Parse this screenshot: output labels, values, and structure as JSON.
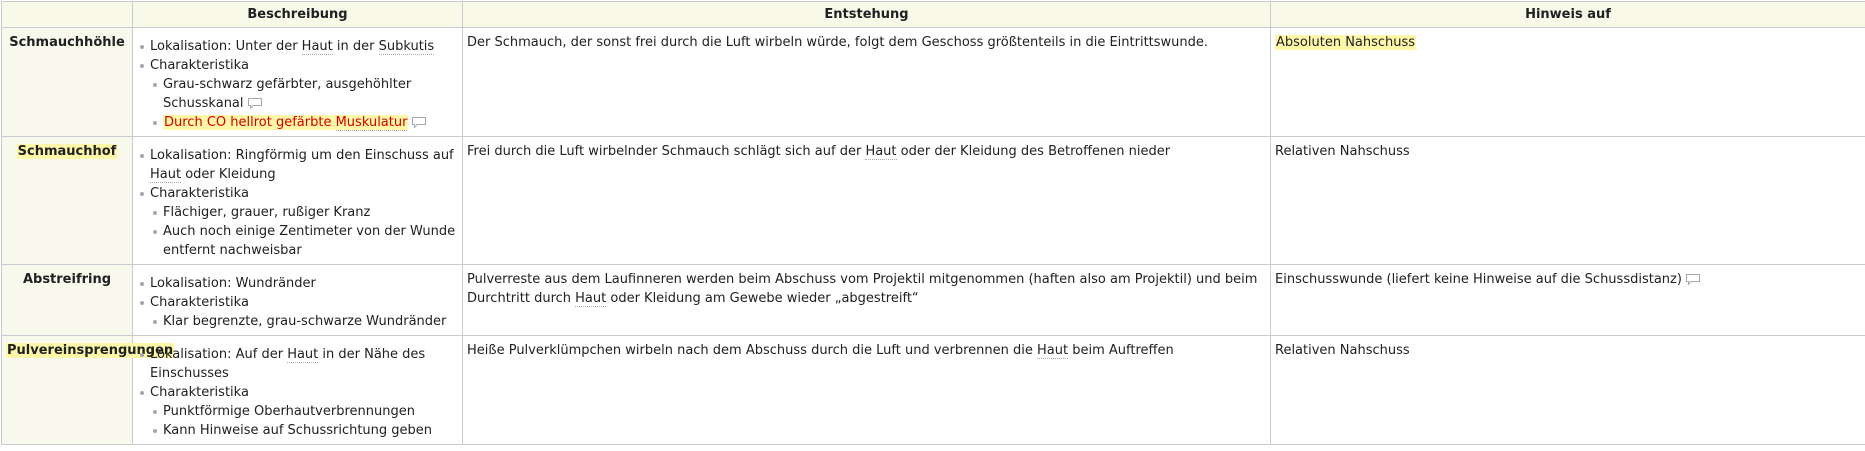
{
  "header": {
    "col_label": "",
    "col_beschreibung": "Beschreibung",
    "col_entstehung": "Entstehung",
    "col_hinweis": "Hinweis auf"
  },
  "rows": [
    {
      "label": "Schmauchhöhle",
      "lokalisation_prefix": "Lokalisation: Unter der ",
      "lokalisation_link1": "Haut",
      "lokalisation_mid": " in der ",
      "lokalisation_link2": "Subkutis",
      "charakteristika": "Charakteristika",
      "sub1": "Grau-schwarz gefärbter, ausgehöhlter Schusskanal",
      "sub2_prefix": "Durch CO hellrot gefärbte ",
      "sub2_link": "Muskulatur",
      "entstehung": "Der Schmauch, der sonst frei durch die Luft wirbeln würde, folgt dem Geschoss größtenteils in die Eintrittswunde.",
      "hinweis": "Absoluten Nahschuss"
    },
    {
      "label": "Schmauchhof",
      "lokalisation_prefix": "Lokalisation: Ringförmig um den Einschuss auf ",
      "lokalisation_link": "Haut",
      "lokalisation_suffix": " oder Kleidung",
      "charakteristika": "Charakteristika",
      "sub1": "Flächiger, grauer, rußiger Kranz",
      "sub2": "Auch noch einige Zentimeter von der Wunde entfernt nachweisbar",
      "entstehung_prefix": "Frei durch die Luft wirbelnder Schmauch schlägt sich auf der ",
      "entstehung_link": "Haut",
      "entstehung_suffix": " oder der Kleidung des Betroffenen nieder",
      "hinweis": "Relativen Nahschuss"
    },
    {
      "label": "Abstreifring",
      "lokalisation": "Lokalisation: Wundränder",
      "charakteristika": "Charakteristika",
      "sub1": "Klar begrenzte, grau-schwarze Wundränder",
      "entstehung_prefix": "Pulverreste aus dem Laufinneren werden beim Abschuss vom Projektil mitgenommen (haften also am Projektil) und beim Durchtritt durch ",
      "entstehung_link": "Haut",
      "entstehung_suffix": " oder Kleidung am Gewebe wieder „abgestreift“",
      "hinweis": "Einschusswunde (liefert keine Hinweise auf die Schussdistanz)"
    },
    {
      "label": "Pulvereinsprengungen",
      "lokalisation_prefix": "Lokalisation: Auf der ",
      "lokalisation_link": "Haut",
      "lokalisation_suffix": " in der Nähe des Einschusses",
      "charakteristika": "Charakteristika",
      "sub1": "Punktförmige Oberhautverbrennungen",
      "sub2": "Kann Hinweise auf Schussrichtung geben",
      "entstehung_prefix": "Heiße Pulverklümpchen wirbeln nach dem Abschuss durch die Luft und verbrennen die ",
      "entstehung_link": "Haut",
      "entstehung_suffix": " beim Auftreffen",
      "hinweis": "Relativen Nahschuss"
    }
  ],
  "icons": {
    "comment": "comment-icon"
  },
  "colors": {
    "highlight": "#fdf7a7",
    "header_bg": "#f8f9e9",
    "red_text": "#d40000",
    "border": "#c8ccd1"
  }
}
